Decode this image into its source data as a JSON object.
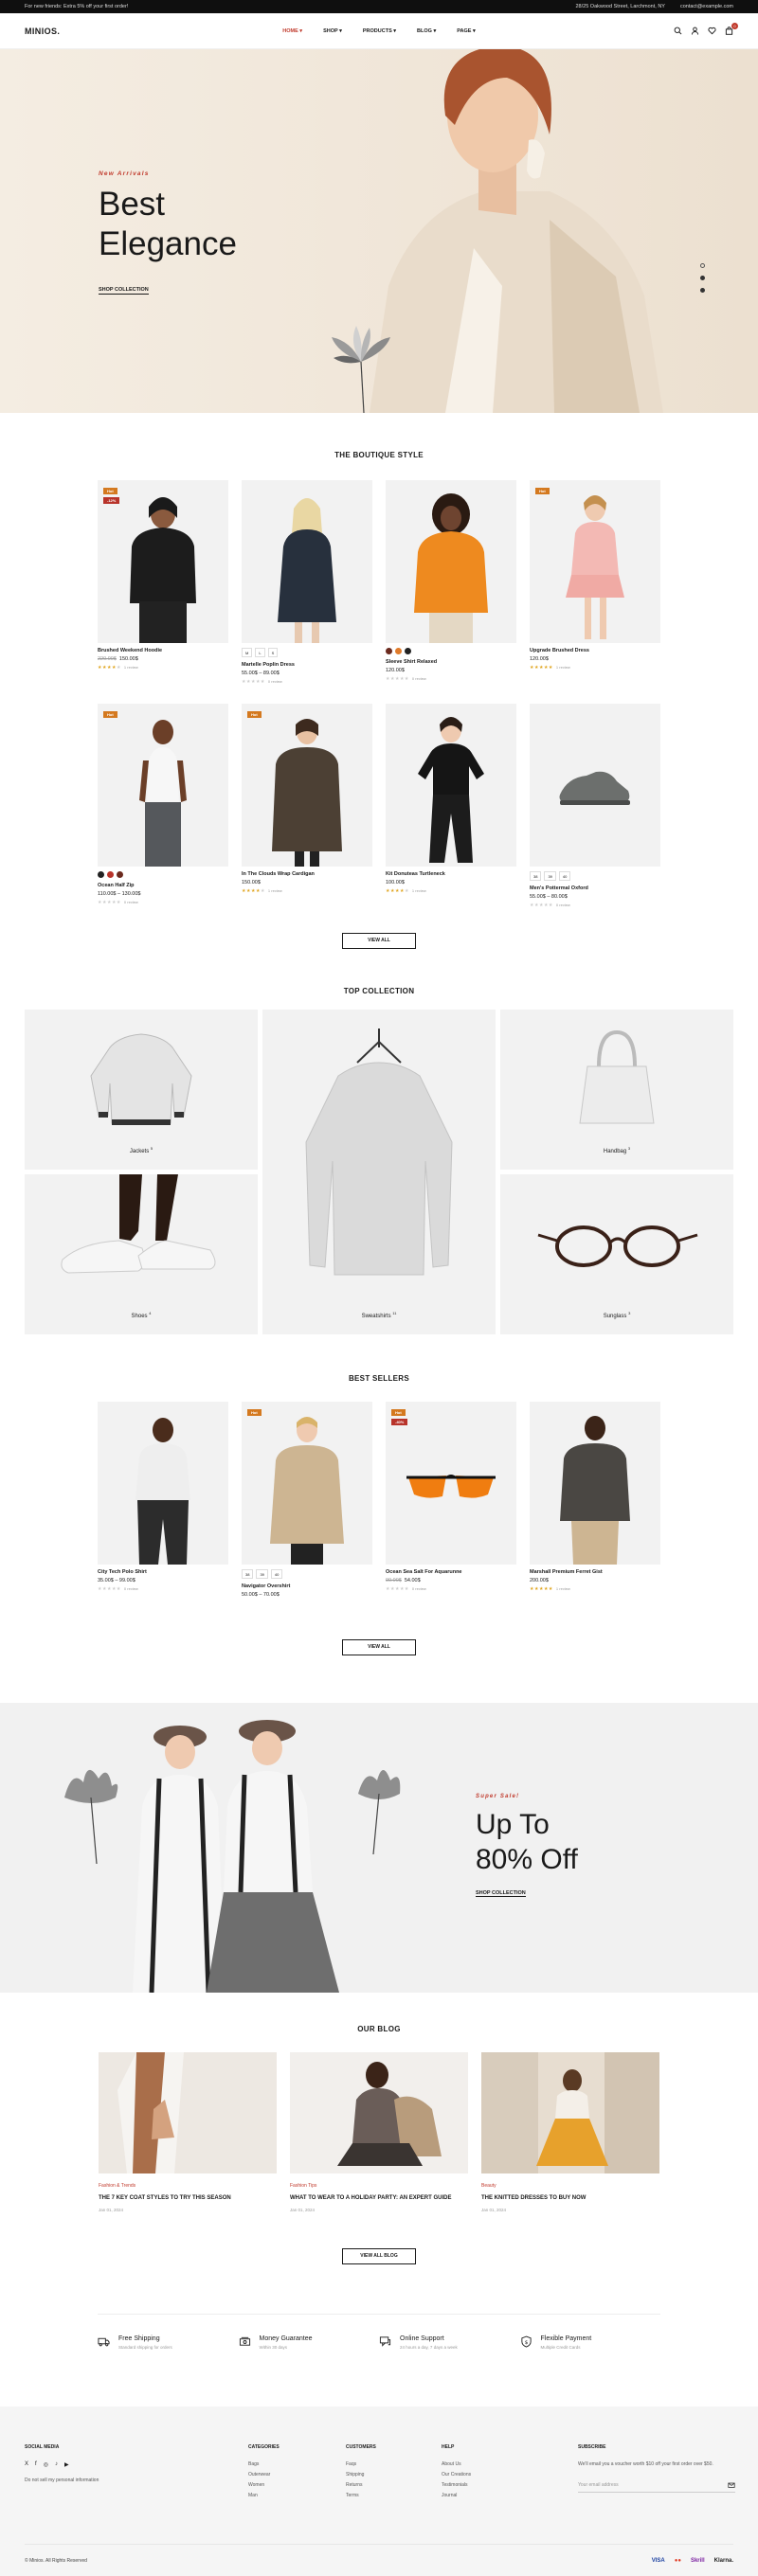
{
  "topbar": {
    "promo": "For new friends: Extra 5% off your first order!",
    "address": "28/25 Oakwood Street, Larchmont, NY",
    "email": "contact@example.com"
  },
  "header": {
    "logo": "MINIOS.",
    "nav": [
      "HOME",
      "SHOP",
      "PRODUCTS",
      "BLOG",
      "PAGE"
    ],
    "cart_count": "0"
  },
  "hero": {
    "subtitle": "New Arrivals",
    "title": "Best Elegance",
    "cta": "SHOP COLLECTION"
  },
  "boutique": {
    "title": "THE BOUTIQUE STYLE",
    "view_all": "VIEW ALL",
    "products": [
      {
        "name": "Brushed Weekend Hoodie",
        "old_price": "220.00$",
        "price": "150.00$",
        "badge": "Hot",
        "sale": "-12%",
        "reviews": "1 review",
        "stars": 4
      },
      {
        "name": "Martelle Poplin Dress",
        "price": "55.00$ – 89.00$",
        "sizes": [
          "M",
          "L",
          "S"
        ],
        "reviews": "0 review",
        "stars": 0
      },
      {
        "name": "Sleeve Shirt Relaxed",
        "price": "120.00$",
        "swatches": [
          "#6b2a1e",
          "#e07b2a",
          "#222"
        ],
        "reviews": "0 review",
        "stars": 0
      },
      {
        "name": "Upgrade Brushed Dress",
        "price": "120.00$",
        "badge": "Hot",
        "reviews": "1 review",
        "stars": 5
      },
      {
        "name": "Ocean Half Zip",
        "price": "110.00$ – 130.00$",
        "badge": "Hot",
        "swatches": [
          "#222",
          "#b8332a",
          "#6b2a1e"
        ],
        "reviews": "0 review",
        "stars": 0
      },
      {
        "name": "In The Clouds Wrap Cardigan",
        "price": "150.00$",
        "badge": "Hot",
        "reviews": "1 review",
        "stars": 4
      },
      {
        "name": "Kit Donuteas Turtleneck",
        "price": "100.00$",
        "reviews": "1 review",
        "stars": 4
      },
      {
        "name": "Men's Pottermal Oxford",
        "price": "55.00$ – 80.00$",
        "sizes": [
          "38",
          "39",
          "40"
        ],
        "reviews": "0 review",
        "stars": 0
      }
    ]
  },
  "collection": {
    "title": "TOP COLLECTION",
    "items": [
      {
        "label": "Jackets",
        "count": "5"
      },
      {
        "label": "Sweatshirts",
        "count": "11"
      },
      {
        "label": "Handbag",
        "count": "3"
      },
      {
        "label": "Shoes",
        "count": "4"
      },
      {
        "label": "Sunglass",
        "count": "3"
      }
    ]
  },
  "bestsellers": {
    "title": "BEST SELLERS",
    "view_all": "VIEW ALL",
    "products": [
      {
        "name": "City Tech Polo Shirt",
        "price": "35.00$ – 99.00$",
        "reviews": "0 review",
        "stars": 0
      },
      {
        "name": "Navigator Overshirt",
        "price": "50.00$ – 70.00$",
        "badge": "Hot",
        "sizes": [
          "38",
          "39",
          "40"
        ],
        "reviews": "0 review",
        "stars": 0
      },
      {
        "name": "Ocean Sea Salt For Aquarunne",
        "old_price": "90.00$",
        "price": "54.00$",
        "badge": "Hot",
        "sale": "-40%",
        "reviews": "0 review",
        "stars": 0
      },
      {
        "name": "Marshall Premium Ferret Gist",
        "price": "200.00$",
        "reviews": "1 review",
        "stars": 5
      }
    ]
  },
  "banner": {
    "subtitle": "Super Sale!",
    "title": "Up To 80% Off",
    "cta": "SHOP COLLECTION"
  },
  "blog": {
    "title": "OUR BLOG",
    "view_all": "VIEW ALL BLOG",
    "posts": [
      {
        "category": "Fashion & Trends",
        "title": "THE 7 KEY COAT STYLES TO TRY THIS SEASON",
        "date": "Jan 01, 2024"
      },
      {
        "category": "Fashion Tips",
        "title": "WHAT TO WEAR TO A HOLIDAY PARTY: AN EXPERT GUIDE",
        "date": "Jan 01, 2024"
      },
      {
        "category": "Beauty",
        "title": "THE KNITTED DRESSES TO BUY NOW",
        "date": "Jan 01, 2024"
      }
    ]
  },
  "features": [
    {
      "title": "Free Shipping",
      "desc": "Standard shipping for orders"
    },
    {
      "title": "Money Guarantee",
      "desc": "Within 30 days"
    },
    {
      "title": "Online Support",
      "desc": "24 hours a day, 7 days a week"
    },
    {
      "title": "Flexible Payment",
      "desc": "Multiple Credit Cards"
    }
  ],
  "footer": {
    "social_title": "SOCIAL MEDIA",
    "social_icons": [
      "X",
      "f",
      "◎",
      "♪",
      "▶"
    ],
    "privacy": "Do not sell my personal information",
    "categories_title": "CATEGORIES",
    "categories": [
      "Bags",
      "Outerwear",
      "Women",
      "Man"
    ],
    "customers_title": "CUSTOMERS",
    "customers": [
      "Faqs",
      "Shipping",
      "Returns",
      "Terms"
    ],
    "help_title": "HELP",
    "help": [
      "About Us",
      "Our Creations",
      "Testimonials",
      "Journal"
    ],
    "subscribe_title": "SUBSCRIBE",
    "subscribe_text": "We'll email you a voucher worth $10 off your first order over $50.",
    "email_placeholder": "Your email address",
    "copyright": "© Minios. All Rights Reserved",
    "payments": [
      "VISA",
      "●●",
      "Skrill",
      "Klarna."
    ]
  },
  "colors": {
    "accent": "#c0392b",
    "badge_hot": "#d4791f",
    "badge_sale": "#b8332a",
    "hero_bg": "#f1e7da"
  }
}
